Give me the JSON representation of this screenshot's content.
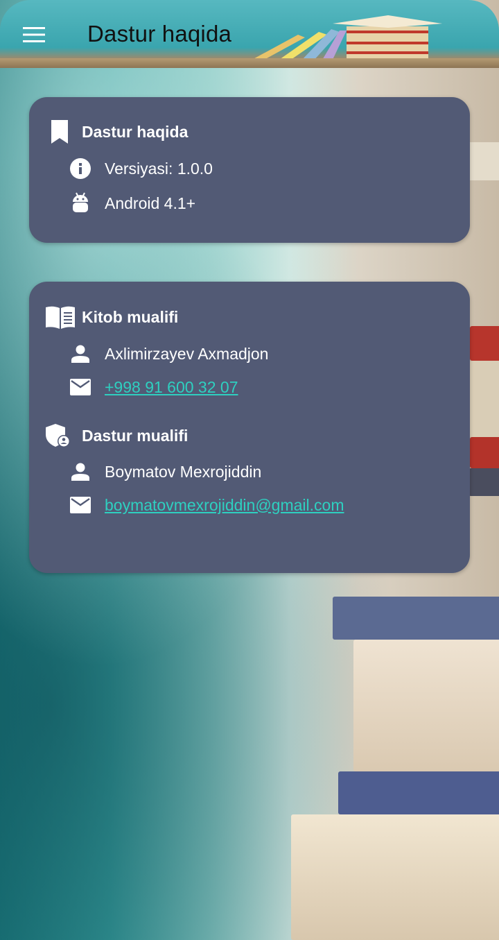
{
  "header": {
    "title": "Dastur haqida",
    "menu_icon": "hamburger-menu-icon"
  },
  "about_card": {
    "heading": "Dastur haqida",
    "heading_icon": "bookmark-icon",
    "version": "Versiyasi: 1.0.0",
    "version_icon": "info-icon",
    "android": "Android 4.1+",
    "android_icon": "android-icon"
  },
  "authors_card": {
    "book_author": {
      "heading": "Kitob mualifi",
      "heading_icon": "open-book-icon",
      "name": "Axlimirzayev Axmadjon",
      "contact": "+998 91 600 32 07"
    },
    "app_author": {
      "heading": "Dastur mualifi",
      "heading_icon": "admin-shield-icon",
      "name": "Boymatov Mexrojiddin",
      "contact": "boymatovmexrojiddin@gmail.com"
    }
  },
  "colors": {
    "card": "#525a75",
    "link": "#2ed0c0",
    "text": "#ffffff"
  }
}
